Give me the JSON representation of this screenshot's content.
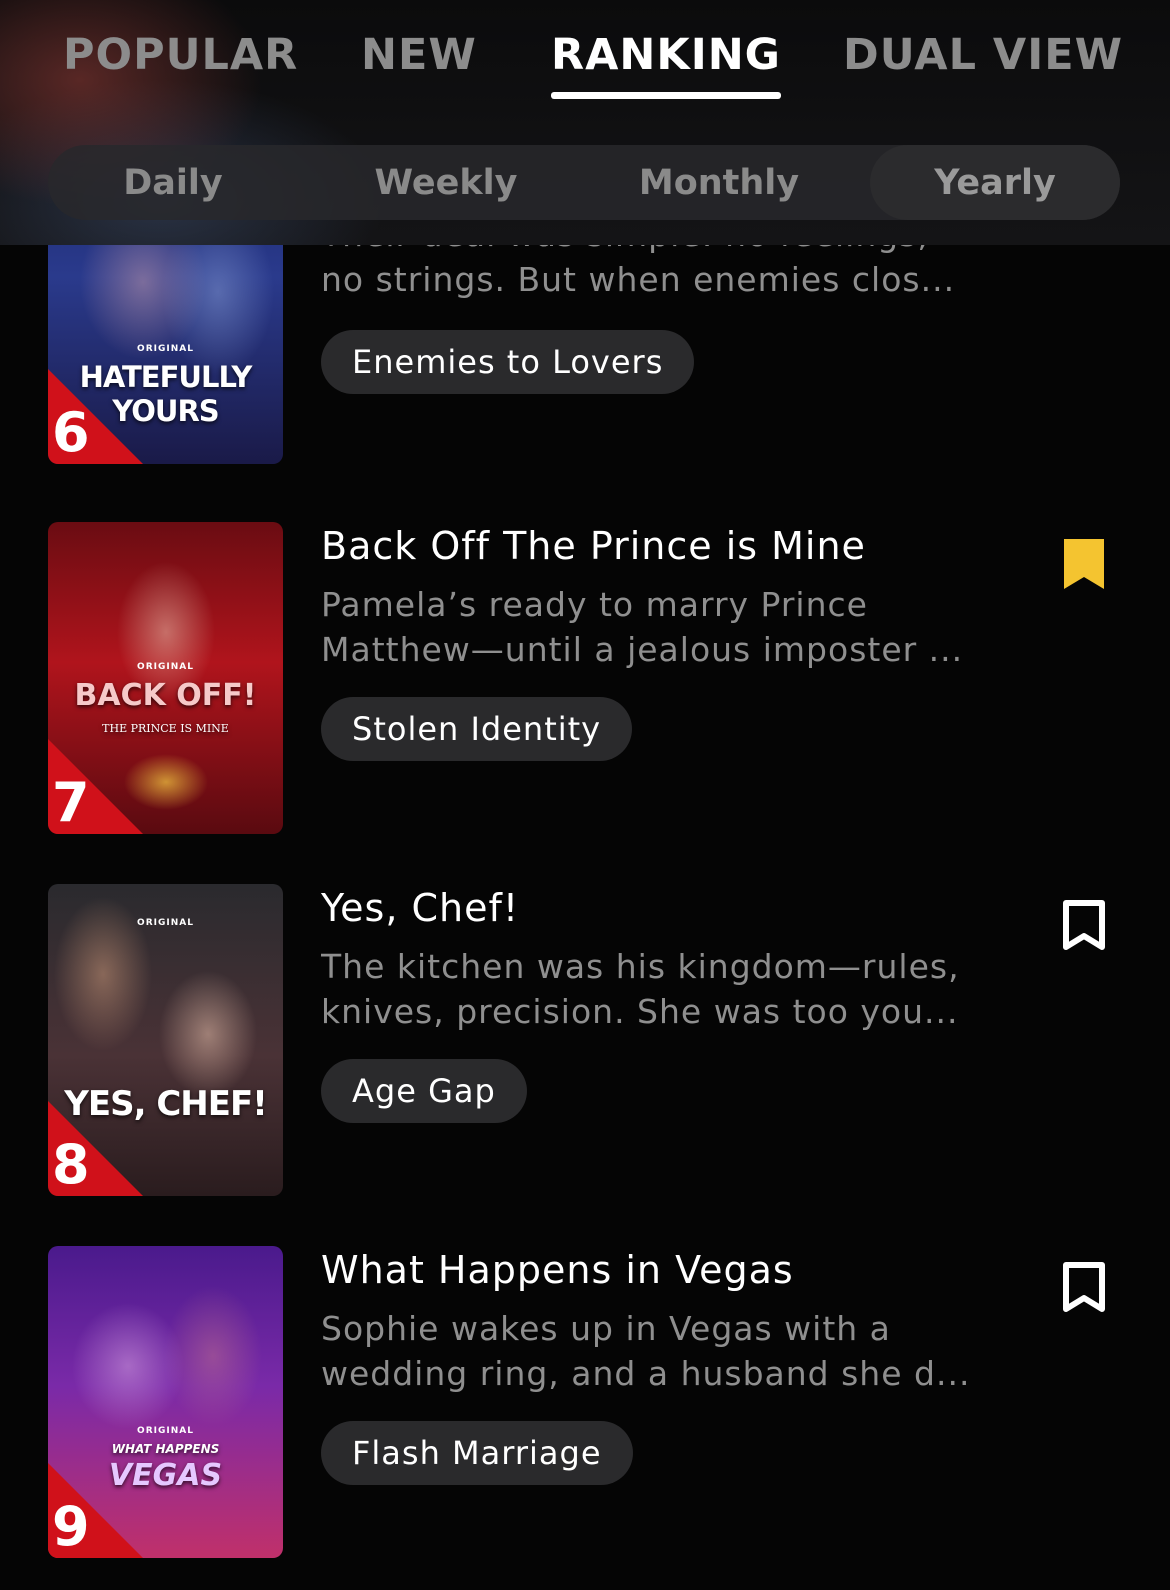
{
  "main_tabs": [
    {
      "label": "POPULAR"
    },
    {
      "label": "NEW"
    },
    {
      "label": "RANKING"
    },
    {
      "label": "DUAL VIEW"
    }
  ],
  "active_main_tab": "RANKING",
  "sub_tabs": [
    {
      "label": "Daily"
    },
    {
      "label": "Weekly"
    },
    {
      "label": "Monthly"
    },
    {
      "label": "Yearly"
    }
  ],
  "active_sub_tab": "Yearly",
  "items": [
    {
      "rank": "6",
      "poster_title": "HATEFULLY YOURS",
      "poster_badge": "ORIGINAL",
      "title": "",
      "desc_line1": "Their deal was simple: no feelings,",
      "desc_line2": "no strings. But when enemies clos...",
      "tag": "Enemies to Lovers",
      "bookmarked": false
    },
    {
      "rank": "7",
      "poster_title": "BACK OFF!",
      "poster_subtitle": "THE PRINCE IS MINE",
      "poster_badge": "ORIGINAL",
      "title": "Back Off The Prince is Mine",
      "desc_line1": "Pamela’s ready to marry Prince",
      "desc_line2": "Matthew—until a jealous imposter ...",
      "tag": "Stolen Identity",
      "bookmarked": true
    },
    {
      "rank": "8",
      "poster_title": "YES, CHEF!",
      "poster_badge": "ORIGINAL",
      "title": "Yes, Chef!",
      "desc_line1": "The kitchen was his kingdom—rules,",
      "desc_line2": "knives, precision. She was too you...",
      "tag": "Age Gap",
      "bookmarked": false
    },
    {
      "rank": "9",
      "poster_title": "VEGAS",
      "poster_subtitle": "WHAT HAPPENS",
      "poster_badge": "ORIGINAL",
      "title": "What Happens in Vegas",
      "desc_line1": "Sophie wakes up in Vegas with a",
      "desc_line2": "wedding ring, and a husband she d...",
      "tag": "Flash Marriage",
      "bookmarked": false
    }
  ],
  "colors": {
    "rank_badge": "#d0111a",
    "bookmark_active": "#f4c430",
    "tag_bg": "#2a2a2c",
    "background": "#050505"
  }
}
